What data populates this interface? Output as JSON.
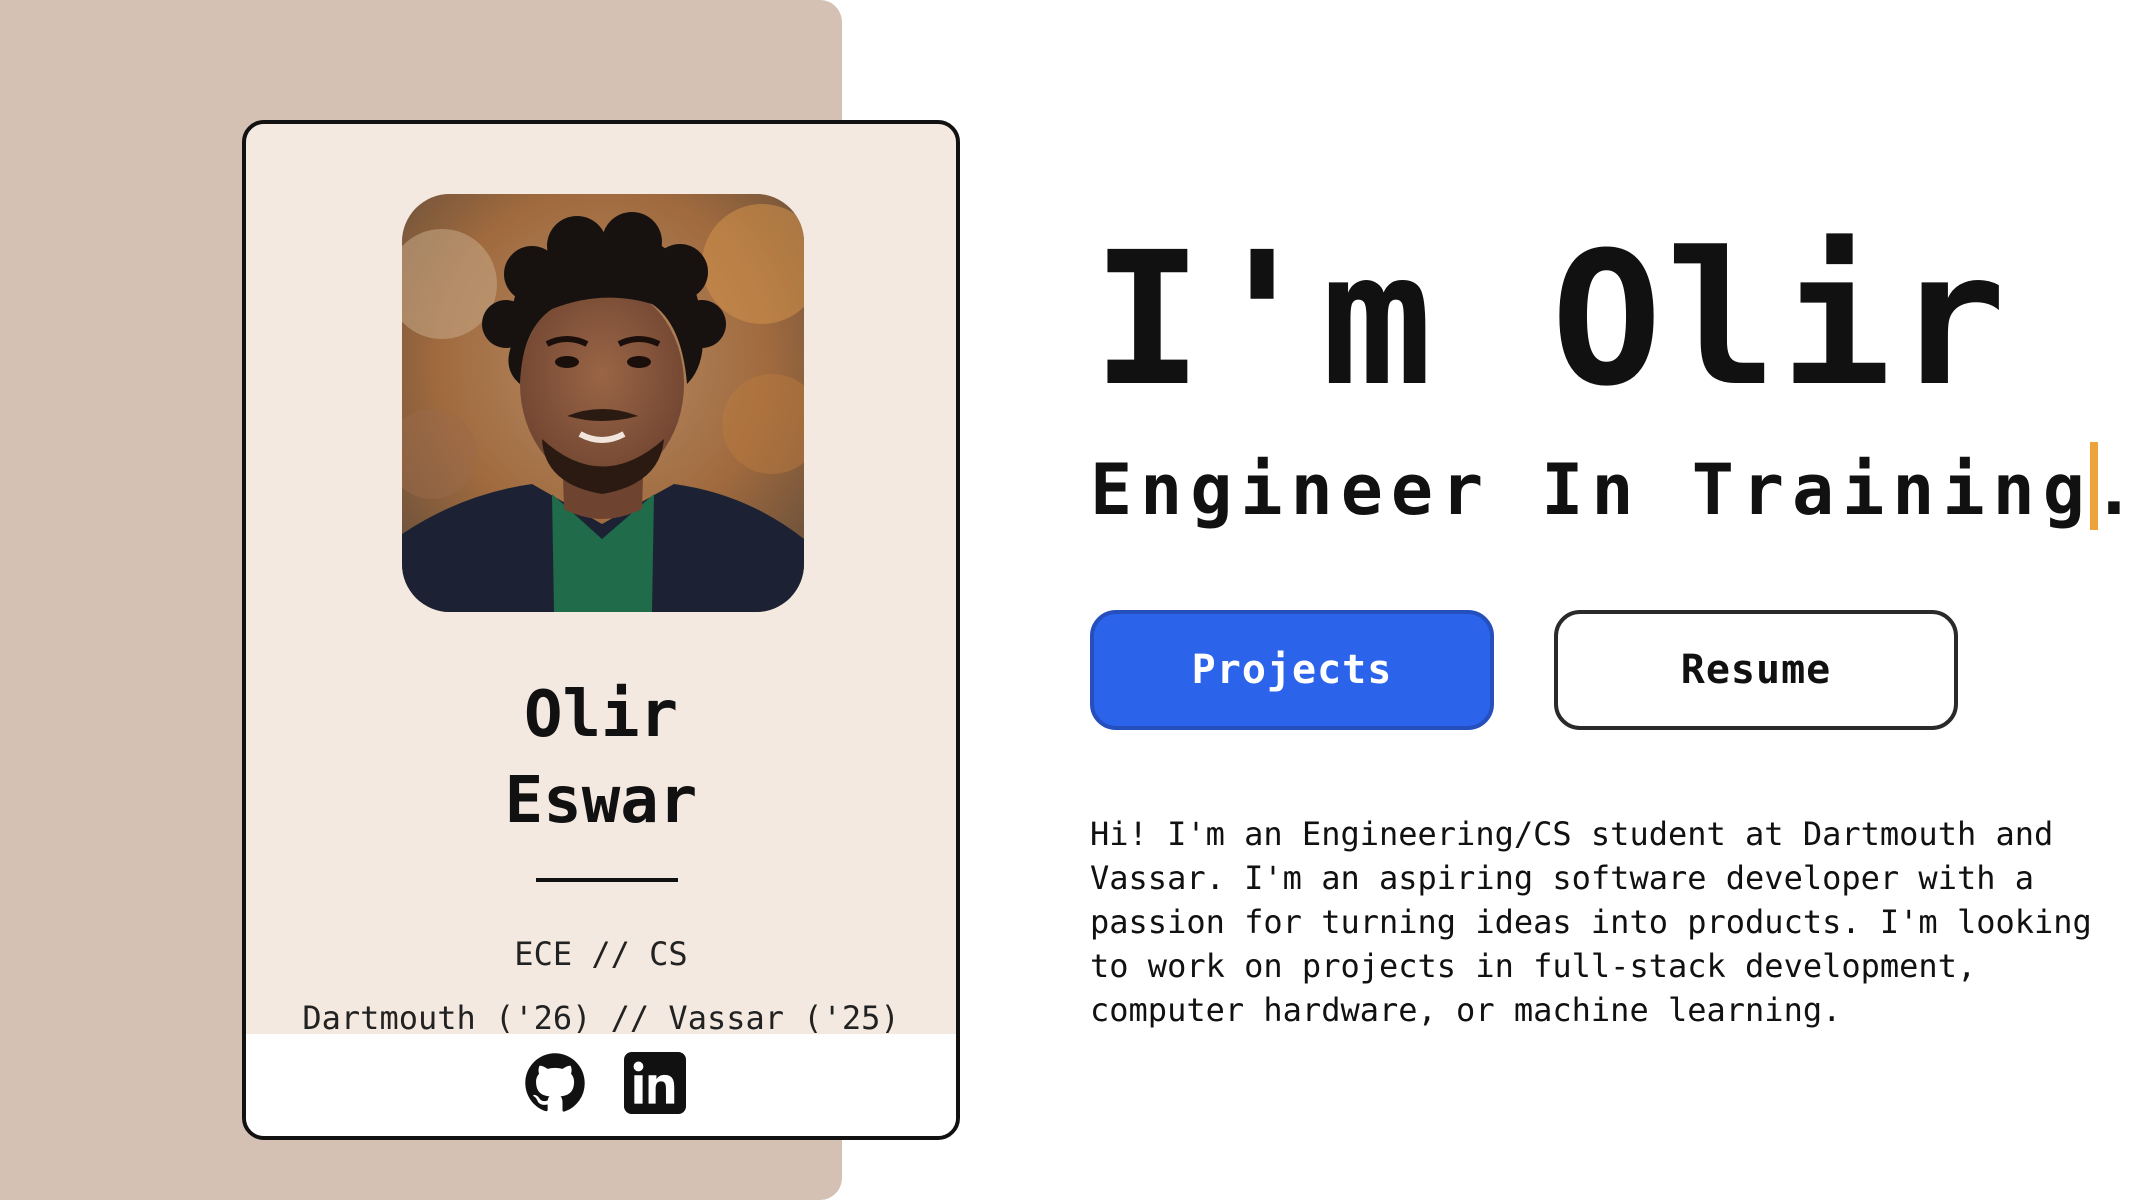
{
  "profile_card": {
    "first_name": "Olir",
    "last_name": "Eswar",
    "major": "ECE // CS",
    "schools": "Dartmouth ('26) // Vassar ('25)",
    "socials": [
      "github-icon",
      "linkedin-icon"
    ]
  },
  "hero": {
    "headline": "I'm Olir",
    "tagline": "Engineer In Training.",
    "cursor_color": "#eea23a"
  },
  "actions": {
    "projects_label": "Projects",
    "resume_label": "Resume",
    "projects_color": "#2b63ea"
  },
  "bio": {
    "text": "Hi! I'm an Engineering/CS student at Dartmouth and Vassar. I'm an aspiring software developer with a passion for turning ideas into products. I'm looking to work on projects in full-stack development, computer hardware, or machine learning."
  },
  "colors": {
    "backdrop": "#d5c1b4",
    "card": "#f3e9e0"
  }
}
